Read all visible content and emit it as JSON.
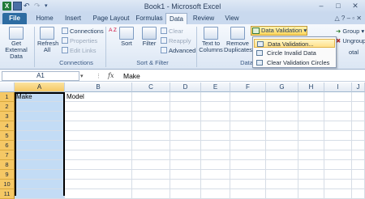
{
  "window": {
    "title": "Book1 - Microsoft Excel"
  },
  "tabs": [
    "File",
    "Home",
    "Insert",
    "Page Layout",
    "Formulas",
    "Data",
    "Review",
    "View"
  ],
  "active_tab": "Data",
  "ribbon": {
    "get_external_data": "Get External Data",
    "refresh_all": "Refresh All",
    "connections": "Connections",
    "properties": "Properties",
    "edit_links": "Edit Links",
    "connections_group": "Connections",
    "sort_az": "A Z",
    "sort": "Sort",
    "filter": "Filter",
    "clear": "Clear",
    "reapply": "Reapply",
    "advanced": "Advanced",
    "sort_filter_group": "Sort & Filter",
    "text_to_columns": "Text to Columns",
    "remove_duplicates": "Remove Duplicates",
    "data_tools_group": "Data",
    "data_validation": "Data Validation",
    "group": "Group",
    "ungroup": "Ungroup",
    "subtotal": "otal"
  },
  "dropdown": {
    "items": [
      "Data Validation...",
      "Circle Invalid Data",
      "Clear Validation Circles"
    ]
  },
  "formula_bar": {
    "name_box": "A1",
    "fx": "fx",
    "value": "Make"
  },
  "grid": {
    "columns": [
      "A",
      "B",
      "C",
      "D",
      "E",
      "F",
      "G",
      "H",
      "I",
      "J"
    ],
    "rows": [
      "1",
      "2",
      "3",
      "4",
      "5",
      "6",
      "7",
      "8",
      "9",
      "10",
      "11"
    ],
    "cells": {
      "A1": "Make",
      "B1": "Model"
    }
  },
  "colors": {
    "accent": "#2d6ca2",
    "selection": "#c3dcf5",
    "header_selected": "#f5c865"
  }
}
